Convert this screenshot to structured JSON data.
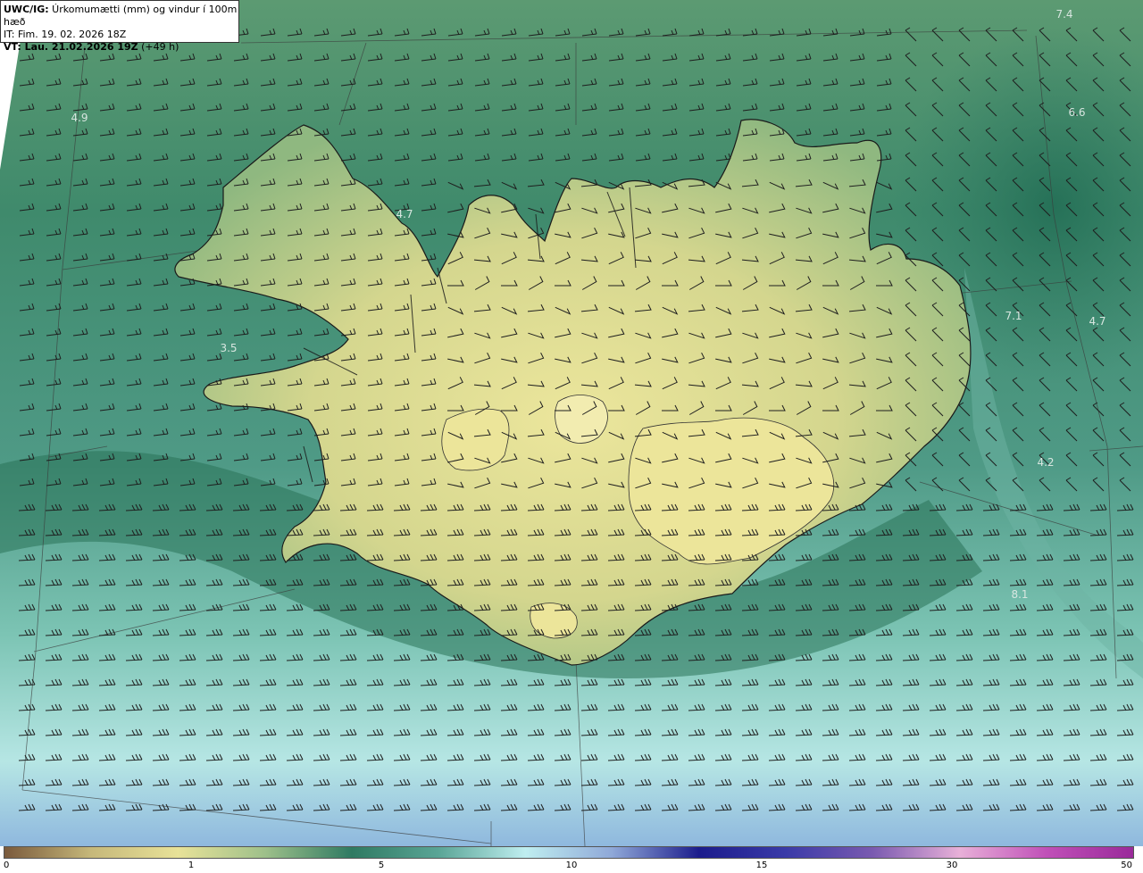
{
  "header": {
    "model": "UWC/IG:",
    "title": " Úrkomumætti (mm) og vindur í 100m hæð",
    "init_time": "IT: Fim. 19. 02. 2026 18Z",
    "valid_prefix": "VT: Lau. 21.02.2026 19Z",
    "lead": " (+49 h)"
  },
  "value_labels": [
    "4.9",
    "4.7",
    "3.5",
    "7.4",
    "6.6",
    "7.1",
    "4.7",
    "4.2",
    "8.1"
  ],
  "colorbar": {
    "ticks": [
      "0",
      "1",
      "5",
      "10",
      "15",
      "30",
      "50"
    ],
    "stops": [
      "#7a5a3c",
      "#c6b87a",
      "#e8e298",
      "#9ec08a",
      "#2f7a62",
      "#5aa596",
      "#bfeef0",
      "#8fa8d8",
      "#1c1c8c",
      "#3a3aa8",
      "#7a5ab0",
      "#e8b0d8",
      "#c050b8",
      "#9a2a9a"
    ]
  },
  "colors": {
    "sea_dark": "#2f7a62",
    "sea_light": "#bfeef0",
    "land_yellow": "#e8e298",
    "coast": "#1a1a1a"
  }
}
